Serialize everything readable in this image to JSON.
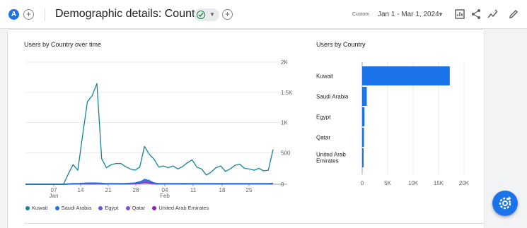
{
  "header": {
    "avatar_letter": "A",
    "title": "Demographic details: Country",
    "date_label": "Custom",
    "date_range": "Jan 1 - Mar 1, 2024"
  },
  "icons": [
    "plus-icon",
    "check-icon",
    "chevron-down-icon",
    "compare-icon",
    "share-icon",
    "insights-icon",
    "edit-icon",
    "settings-icon"
  ],
  "colors": {
    "accent": "#1a73e8",
    "line_kuwait": "#12839a",
    "line_saudi": "#1a73e8",
    "line_egypt": "#5b5bd6",
    "line_qatar": "#7b4fd6",
    "line_uae": "#8a1fb0"
  },
  "line_chart": {
    "title": "Users by Country over time",
    "y_ticks": [
      "2K",
      "1.5K",
      "1K",
      "500",
      "0"
    ],
    "x_ticks": [
      {
        "day": "07",
        "month": "Jan"
      },
      {
        "day": "14",
        "month": ""
      },
      {
        "day": "21",
        "month": ""
      },
      {
        "day": "28",
        "month": ""
      },
      {
        "day": "04",
        "month": "Feb"
      },
      {
        "day": "11",
        "month": ""
      },
      {
        "day": "18",
        "month": ""
      },
      {
        "day": "25",
        "month": ""
      }
    ],
    "legend": [
      "Kuwait",
      "Saudi Arabia",
      "Egypt",
      "Qatar",
      "United Arab Emirates"
    ]
  },
  "chart_data": [
    {
      "type": "line",
      "title": "Users by Country over time",
      "xlabel": "",
      "ylabel": "",
      "ylim": [
        0,
        2000
      ],
      "x": [
        "Jan 1",
        "Jan 3",
        "Jan 5",
        "Jan 7",
        "Jan 9",
        "Jan 11",
        "Jan 13",
        "Jan 15",
        "Jan 17",
        "Jan 18",
        "Jan 19",
        "Jan 20",
        "Jan 21",
        "Jan 22",
        "Jan 23",
        "Jan 24",
        "Jan 25",
        "Jan 26",
        "Jan 27",
        "Jan 28",
        "Jan 29",
        "Jan 30",
        "Jan 31",
        "Feb 1",
        "Feb 2",
        "Feb 3",
        "Feb 4",
        "Feb 5",
        "Feb 6",
        "Feb 7",
        "Feb 8",
        "Feb 9",
        "Feb 10",
        "Feb 11",
        "Feb 12",
        "Feb 13",
        "Feb 14",
        "Feb 15",
        "Feb 16",
        "Feb 17",
        "Feb 18",
        "Feb 19",
        "Feb 20",
        "Feb 21",
        "Feb 22",
        "Feb 23",
        "Feb 24",
        "Feb 25",
        "Feb 26",
        "Feb 27",
        "Feb 28",
        "Feb 29",
        "Mar 1"
      ],
      "series": [
        {
          "name": "Kuwait",
          "values": [
            0,
            0,
            0,
            0,
            0,
            0,
            0,
            0,
            0,
            170,
            320,
            230,
            800,
            1350,
            1450,
            1650,
            420,
            270,
            320,
            340,
            340,
            290,
            250,
            230,
            280,
            620,
            490,
            410,
            280,
            300,
            270,
            300,
            250,
            290,
            350,
            400,
            280,
            250,
            150,
            200,
            270,
            300,
            210,
            250,
            310,
            330,
            260,
            250,
            230,
            260,
            220,
            230,
            570
          ]
        },
        {
          "name": "Saudi Arabia",
          "values": [
            0,
            0,
            0,
            0,
            0,
            0,
            0,
            0,
            0,
            5,
            10,
            10,
            15,
            20,
            20,
            20,
            15,
            10,
            10,
            10,
            10,
            12,
            15,
            20,
            30,
            80,
            60,
            20,
            10,
            10,
            10,
            10,
            10,
            12,
            10,
            10,
            10,
            10,
            10,
            10,
            10,
            12,
            10,
            10,
            10,
            10,
            10,
            10,
            10,
            10,
            10,
            10,
            15
          ]
        },
        {
          "name": "Egypt",
          "values": [
            0,
            0,
            0,
            0,
            0,
            0,
            0,
            0,
            0,
            5,
            8,
            8,
            10,
            12,
            12,
            12,
            10,
            8,
            8,
            8,
            8,
            10,
            12,
            20,
            40,
            60,
            50,
            20,
            8,
            8,
            8,
            8,
            8,
            10,
            8,
            8,
            8,
            8,
            8,
            8,
            8,
            10,
            8,
            8,
            8,
            8,
            8,
            8,
            8,
            8,
            8,
            8,
            10
          ]
        },
        {
          "name": "Qatar",
          "values": [
            0,
            0,
            0,
            0,
            0,
            0,
            0,
            0,
            0,
            3,
            5,
            5,
            6,
            8,
            8,
            8,
            6,
            5,
            5,
            5,
            5,
            6,
            8,
            12,
            25,
            40,
            35,
            12,
            5,
            5,
            5,
            5,
            5,
            6,
            5,
            5,
            5,
            5,
            5,
            5,
            5,
            6,
            5,
            5,
            5,
            5,
            5,
            5,
            5,
            5,
            5,
            5,
            6
          ]
        },
        {
          "name": "United Arab Emirates",
          "values": [
            0,
            0,
            0,
            0,
            0,
            0,
            0,
            0,
            0,
            2,
            3,
            3,
            4,
            5,
            5,
            5,
            4,
            3,
            3,
            3,
            3,
            4,
            5,
            8,
            15,
            25,
            20,
            8,
            3,
            3,
            3,
            3,
            3,
            4,
            3,
            3,
            3,
            3,
            3,
            3,
            3,
            4,
            3,
            3,
            3,
            3,
            3,
            3,
            3,
            3,
            3,
            3,
            4
          ]
        }
      ]
    },
    {
      "type": "bar",
      "title": "Users by Country",
      "orientation": "horizontal",
      "categories": [
        "Kuwait",
        "Saudi Arabia",
        "Egypt",
        "Qatar",
        "United Arab Emirates"
      ],
      "values": [
        17200,
        900,
        450,
        350,
        250
      ],
      "x_ticks": [
        "0",
        "5K",
        "10K",
        "15K",
        "20K"
      ],
      "xlim": [
        0,
        20000
      ]
    }
  ],
  "bar_chart": {
    "title": "Users by Country",
    "labels": [
      "Kuwait",
      "Saudi Arabia",
      "Egypt",
      "Qatar",
      "United Arab",
      "Emirates"
    ],
    "x_ticks": [
      "0",
      "5K",
      "10K",
      "15K",
      "20K"
    ]
  }
}
